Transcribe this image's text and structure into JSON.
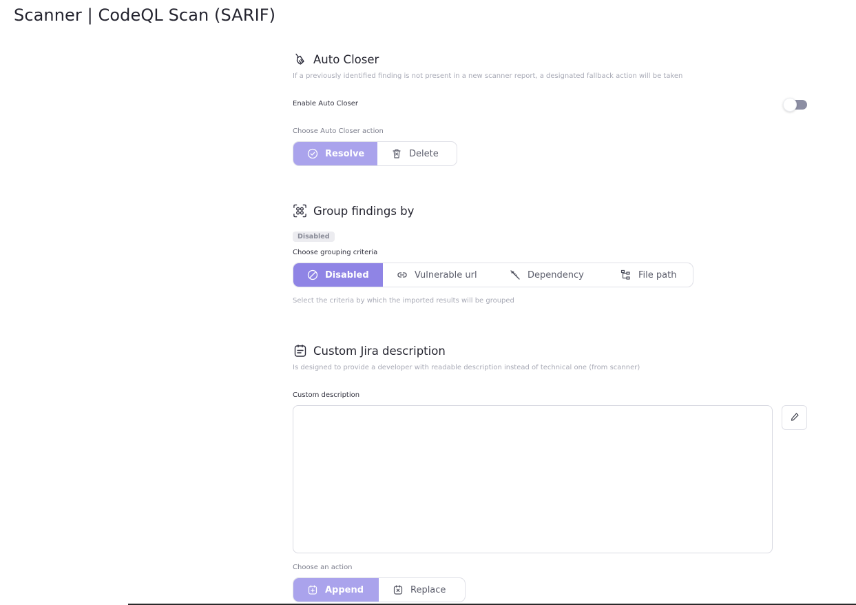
{
  "page": {
    "title": "Scanner | CodeQL Scan (SARIF)"
  },
  "auto_closer": {
    "title": "Auto Closer",
    "description": "If a previously identified finding is not present in a new scanner report, a designated fallback action will be taken",
    "enable_label": "Enable Auto Closer",
    "enabled": false,
    "action_label": "Choose Auto Closer action",
    "actions": [
      {
        "label": "Resolve",
        "icon": "check-circle-icon",
        "selected": true
      },
      {
        "label": "Delete",
        "icon": "trash-icon",
        "selected": false
      }
    ]
  },
  "grouping": {
    "title": "Group findings by",
    "badge": "Disabled",
    "criteria_label": "Choose grouping criteria",
    "options": [
      {
        "label": "Disabled",
        "icon": "disabled-icon",
        "selected": true
      },
      {
        "label": "Vulnerable url",
        "icon": "link-icon",
        "selected": false
      },
      {
        "label": "Dependency",
        "icon": "syringe-icon",
        "selected": false
      },
      {
        "label": "File path",
        "icon": "file-tree-icon",
        "selected": false
      }
    ],
    "hint": "Select the criteria by which the imported results will be grouped"
  },
  "jira": {
    "title": "Custom Jira description",
    "description": "Is designed to provide a developer with readable description instead of technical one (from scanner)",
    "field_label": "Custom description",
    "field_value": "",
    "action_label": "Choose an action",
    "actions": [
      {
        "label": "Append",
        "icon": "append-icon",
        "selected": true
      },
      {
        "label": "Replace",
        "icon": "replace-icon",
        "selected": false
      }
    ]
  },
  "colors": {
    "accent": "#8f84e5",
    "accent_light": "#aaa3ec",
    "toggle_off": "#8c8ea3"
  }
}
